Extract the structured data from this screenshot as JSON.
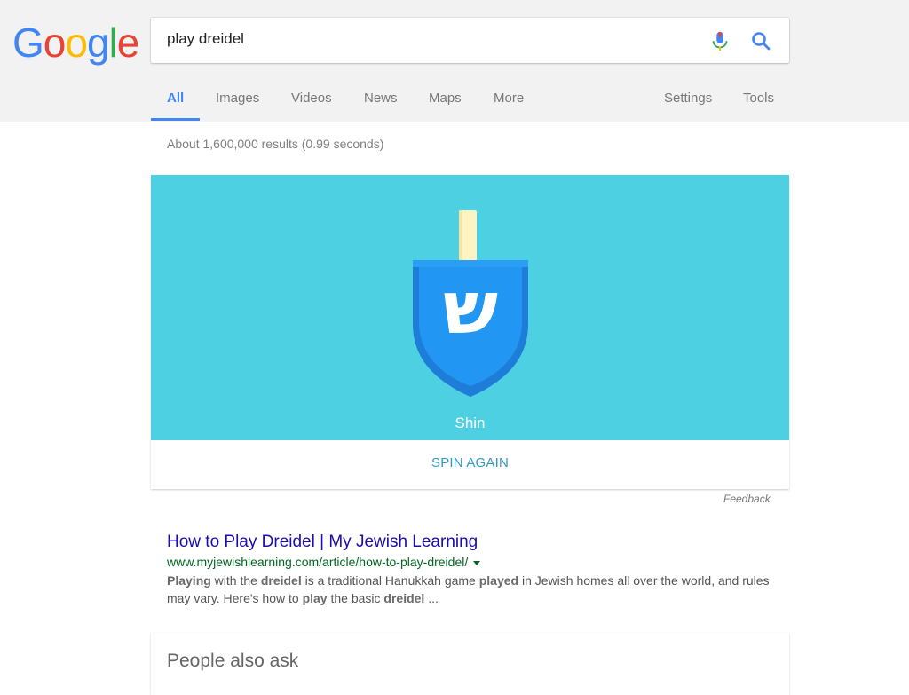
{
  "logo": [
    "G",
    "o",
    "o",
    "g",
    "l",
    "e"
  ],
  "logo_colors": [
    "#4285f4",
    "#ea4335",
    "#fbbc05",
    "#4285f4",
    "#34a853",
    "#ea4335"
  ],
  "search": {
    "value": "play dreidel"
  },
  "tabs": {
    "all": "All",
    "images": "Images",
    "videos": "Videos",
    "news": "News",
    "maps": "Maps",
    "more": "More",
    "settings": "Settings",
    "tools": "Tools"
  },
  "stats": "About 1,600,000 results (0.99 seconds)",
  "dreidel_game": {
    "letter": "ש",
    "letter_name": "Shin",
    "spin_label": "SPIN AGAIN",
    "bg_color": "#4dd0e1"
  },
  "feedback": "Feedback",
  "result": {
    "title": "How to Play Dreidel | My Jewish Learning",
    "url": "www.myjewishlearning.com/article/how-to-play-dreidel/",
    "snippet": [
      {
        "t": "Playing",
        "b": true
      },
      {
        "t": " with the ",
        "b": false
      },
      {
        "t": "dreidel",
        "b": true
      },
      {
        "t": " is a traditional Hanukkah game ",
        "b": false
      },
      {
        "t": "played",
        "b": true
      },
      {
        "t": " in Jewish homes all over the world, and rules may vary. Here's how to ",
        "b": false
      },
      {
        "t": "play",
        "b": true
      },
      {
        "t": " the basic ",
        "b": false
      },
      {
        "t": "dreidel",
        "b": true
      },
      {
        "t": " ...",
        "b": false
      }
    ]
  },
  "people_also_ask": {
    "title": "People also ask"
  },
  "icons": {
    "mic": "mic-icon",
    "search": "search-icon",
    "url_dropdown": "caret-down-icon"
  }
}
